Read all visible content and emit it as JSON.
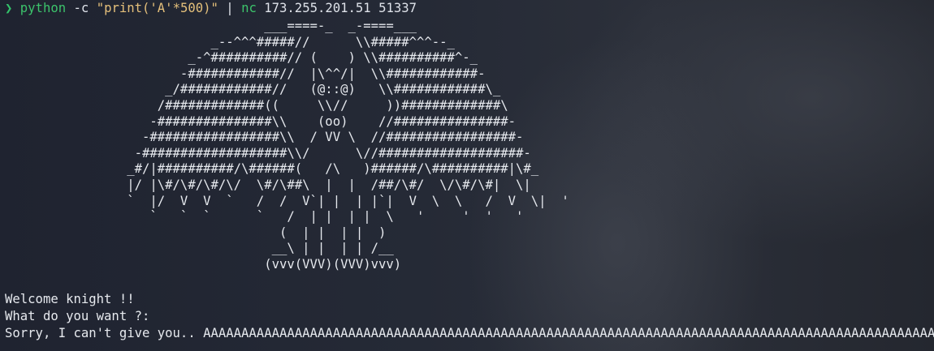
{
  "prompt": {
    "arrow": "❯",
    "command_name": "python",
    "command_flag": "-c",
    "command_string": "\"print('A'*500)\"",
    "pipe": "|",
    "command_name2": "nc",
    "command_args": "173.255.201.51 51337"
  },
  "ascii_art": "                                  ___====-_  _-====___\n                           _--^^^#####//      \\\\#####^^^--_\n                        _-^##########// (    ) \\\\##########^-_\n                       -############//  |\\^^/|  \\\\############-\n                     _/############//   (@::@)   \\\\############\\_\n                    /#############((     \\\\//     ))#############\\\n                   -###############\\\\    (oo)    //###############-\n                  -#################\\\\  / VV \\  //#################-\n                 -###################\\\\/      \\//###################-\n                _#/|##########/\\######(   /\\   )######/\\##########|\\#_\n                |/ |\\#/\\#/\\#/\\/  \\#/\\##\\  |  |  /##/\\#/  \\/\\#/\\#|  \\|\n                `  |/  V  V  `   /  /  V`| |  | |`|  V  \\  \\   /  V  \\|  '\n                   `   `  `      `   /  | |  | |  \\   '     '  '   '\n                                    (  | |  | |  )\n                                   __\\ | |  | | /__\n                                  (vvv(VVV)(VVV)vvv)",
  "output": {
    "welcome": "Welcome knight !!",
    "ask": "What do you want ?:",
    "sorry": "Sorry, I can't give you.. AAAAAAAAAAAAAAAAAAAAAAAAAAAAAAAAAAAAAAAAAAAAAAAAAAAAAAAAAAAAAAAAAAAAAAAAAAAAAAAAAAAAAAAAAAAAAAAAAAAAAAAA"
  },
  "colors": {
    "prompt_green": "#3cc36b",
    "string_yellow": "#e5c07b",
    "text": "#e6e9ee"
  }
}
